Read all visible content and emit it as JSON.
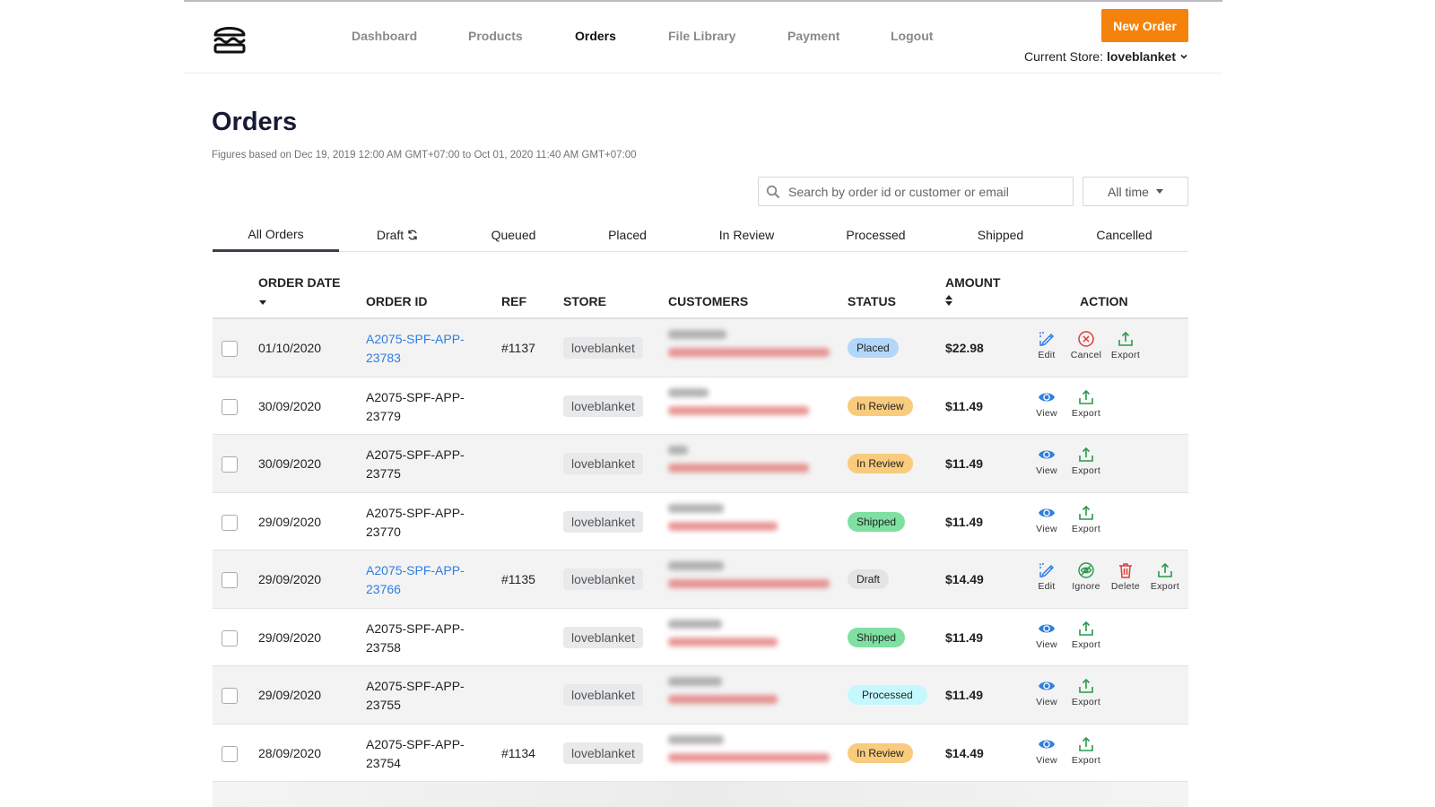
{
  "header": {
    "logo_icon": "burger-icon",
    "nav": [
      {
        "label": "Dashboard",
        "active": false
      },
      {
        "label": "Products",
        "active": false
      },
      {
        "label": "Orders",
        "active": true
      },
      {
        "label": "File Library",
        "active": false
      },
      {
        "label": "Payment",
        "active": false
      },
      {
        "label": "Logout",
        "active": false
      }
    ],
    "new_order_label": "New Order",
    "store_prefix": "Current Store:",
    "store_name": "loveblanket"
  },
  "page": {
    "title": "Orders",
    "subtitle": "Figures based on Dec 19, 2019 12:00 AM GMT+07:00 to Oct 01, 2020 11:40 AM GMT+07:00"
  },
  "filters": {
    "search_placeholder": "Search by order id or customer or email",
    "search_value": "",
    "time_filter": "All time"
  },
  "tabs": [
    {
      "label": "All Orders",
      "active": true
    },
    {
      "label": "Draft",
      "active": false,
      "icon": "refresh-icon"
    },
    {
      "label": "Queued",
      "active": false
    },
    {
      "label": "Placed",
      "active": false
    },
    {
      "label": "In Review",
      "active": false
    },
    {
      "label": "Processed",
      "active": false
    },
    {
      "label": "Shipped",
      "active": false
    },
    {
      "label": "Cancelled",
      "active": false
    }
  ],
  "table": {
    "columns": {
      "order_date": "ORDER DATE",
      "order_id": "ORDER ID",
      "ref": "REF",
      "store": "STORE",
      "customers": "CUSTOMERS",
      "status": "STATUS",
      "amount": "AMOUNT",
      "action": "ACTION"
    },
    "status_colors": {
      "Placed": "#b3d7fb",
      "In Review": "#f9cb7c",
      "Shipped": "#7fe0a1",
      "Draft": "#e4e4e4",
      "Processed": "#c4f8fd"
    },
    "rows": [
      {
        "date": "01/10/2020",
        "order_id_1": "A2075-SPF-APP-",
        "order_id_2": "23783",
        "link": true,
        "ref": "#1137",
        "store": "loveblanket",
        "status": "Placed",
        "amount": "$22.98",
        "actions": [
          {
            "label": "Edit",
            "icon": "edit-icon"
          },
          {
            "label": "Cancel",
            "icon": "cancel-icon"
          },
          {
            "label": "Export",
            "icon": "export-icon"
          }
        ]
      },
      {
        "date": "30/09/2020",
        "order_id_1": "A2075-SPF-APP-",
        "order_id_2": "23779",
        "link": false,
        "ref": "",
        "store": "loveblanket",
        "status": "In Review",
        "amount": "$11.49",
        "actions": [
          {
            "label": "View",
            "icon": "view-icon"
          },
          {
            "label": "Export",
            "icon": "export-icon"
          }
        ]
      },
      {
        "date": "30/09/2020",
        "order_id_1": "A2075-SPF-APP-",
        "order_id_2": "23775",
        "link": false,
        "ref": "",
        "store": "loveblanket",
        "status": "In Review",
        "amount": "$11.49",
        "actions": [
          {
            "label": "View",
            "icon": "view-icon"
          },
          {
            "label": "Export",
            "icon": "export-icon"
          }
        ]
      },
      {
        "date": "29/09/2020",
        "order_id_1": "A2075-SPF-APP-",
        "order_id_2": "23770",
        "link": false,
        "ref": "",
        "store": "loveblanket",
        "status": "Shipped",
        "amount": "$11.49",
        "actions": [
          {
            "label": "View",
            "icon": "view-icon"
          },
          {
            "label": "Export",
            "icon": "export-icon"
          }
        ]
      },
      {
        "date": "29/09/2020",
        "order_id_1": "A2075-SPF-APP-",
        "order_id_2": "23766",
        "link": true,
        "ref": "#1135",
        "store": "loveblanket",
        "status": "Draft",
        "amount": "$14.49",
        "actions": [
          {
            "label": "Edit",
            "icon": "edit-icon"
          },
          {
            "label": "Ignore",
            "icon": "ignore-icon"
          },
          {
            "label": "Delete",
            "icon": "delete-icon"
          },
          {
            "label": "Export",
            "icon": "export-icon"
          }
        ]
      },
      {
        "date": "29/09/2020",
        "order_id_1": "A2075-SPF-APP-",
        "order_id_2": "23758",
        "link": false,
        "ref": "",
        "store": "loveblanket",
        "status": "Shipped",
        "amount": "$11.49",
        "actions": [
          {
            "label": "View",
            "icon": "view-icon"
          },
          {
            "label": "Export",
            "icon": "export-icon"
          }
        ]
      },
      {
        "date": "29/09/2020",
        "order_id_1": "A2075-SPF-APP-",
        "order_id_2": "23755",
        "link": false,
        "ref": "",
        "store": "loveblanket",
        "status": "Processed",
        "amount": "$11.49",
        "actions": [
          {
            "label": "View",
            "icon": "view-icon"
          },
          {
            "label": "Export",
            "icon": "export-icon"
          }
        ]
      },
      {
        "date": "28/09/2020",
        "order_id_1": "A2075-SPF-APP-",
        "order_id_2": "23754",
        "link": false,
        "ref": "#1134",
        "store": "loveblanket",
        "status": "In Review",
        "amount": "$14.49",
        "actions": [
          {
            "label": "View",
            "icon": "view-icon"
          },
          {
            "label": "Export",
            "icon": "export-icon"
          }
        ]
      }
    ]
  }
}
